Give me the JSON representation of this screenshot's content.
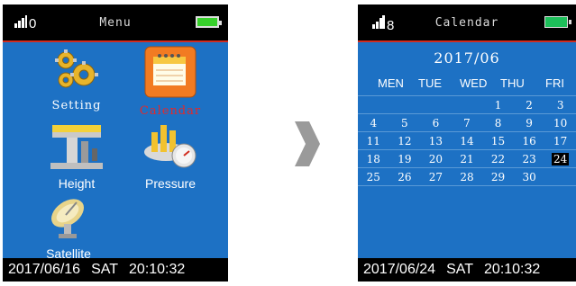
{
  "left_screen": {
    "signal_count": "0",
    "title": "Menu",
    "apps": [
      {
        "id": "setting",
        "label": "Setting"
      },
      {
        "id": "calendar",
        "label": "Calendar"
      },
      {
        "id": "height",
        "label": "Height"
      },
      {
        "id": "pressure",
        "label": "Pressure"
      },
      {
        "id": "satellite",
        "label": "Satellite"
      }
    ],
    "status": {
      "date": "2017/06/16",
      "day": "SAT",
      "time": "20:10:32"
    }
  },
  "right_screen": {
    "signal_count": "8",
    "title": "Calendar",
    "month_title": "2017/06",
    "weekdays": [
      "MEN",
      "TUE",
      "WED",
      "THU",
      "FRI"
    ],
    "rows": [
      [
        "",
        "",
        "",
        "1",
        "2",
        "3"
      ],
      [
        "4",
        "5",
        "6",
        "7",
        "8",
        "9",
        "10"
      ],
      [
        "11",
        "12",
        "13",
        "14",
        "15",
        "16",
        "17"
      ],
      [
        "18",
        "19",
        "20",
        "21",
        "22",
        "23",
        "24"
      ],
      [
        "25",
        "26",
        "27",
        "28",
        "29",
        "30",
        ""
      ]
    ],
    "today": "24",
    "status": {
      "date": "2017/06/24",
      "day": "SAT",
      "time": "20:10:32"
    }
  },
  "colors": {
    "screen_bg": "#1d71c4",
    "status_bar": "#000000",
    "accent_red": "#d12b1e",
    "battery_green": "#37d02b"
  }
}
